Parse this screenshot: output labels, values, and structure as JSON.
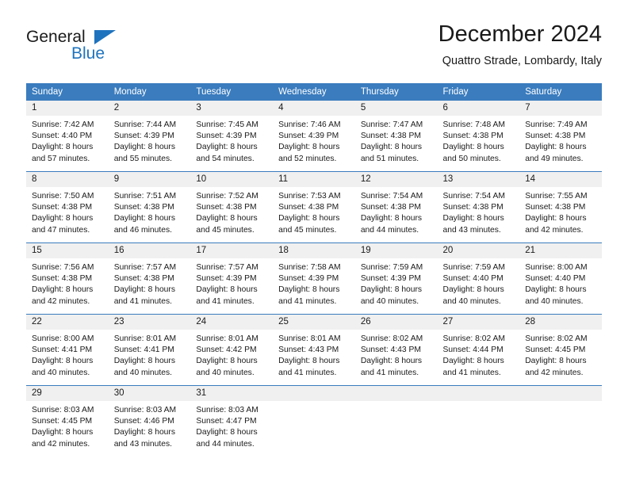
{
  "brand": {
    "name_part1": "General",
    "name_part2": "Blue",
    "triangle_color": "#1e73be",
    "text_color": "#1a1a1a"
  },
  "header": {
    "title": "December 2024",
    "subtitle": "Quattro Strade, Lombardy, Italy"
  },
  "theme": {
    "header_bg": "#3a7cbe",
    "header_text": "#ffffff",
    "daynum_bg": "#f0f0f0",
    "row_border": "#3a7cbe",
    "body_bg": "#ffffff"
  },
  "calendar": {
    "weekday_headers": [
      "Sunday",
      "Monday",
      "Tuesday",
      "Wednesday",
      "Thursday",
      "Friday",
      "Saturday"
    ],
    "labels": {
      "sunrise": "Sunrise:",
      "sunset": "Sunset:",
      "daylight": "Daylight:"
    },
    "weeks": [
      [
        {
          "day": "1",
          "sunrise": "Sunrise: 7:42 AM",
          "sunset": "Sunset: 4:40 PM",
          "daylight_line1": "Daylight: 8 hours",
          "daylight_line2": "and 57 minutes."
        },
        {
          "day": "2",
          "sunrise": "Sunrise: 7:44 AM",
          "sunset": "Sunset: 4:39 PM",
          "daylight_line1": "Daylight: 8 hours",
          "daylight_line2": "and 55 minutes."
        },
        {
          "day": "3",
          "sunrise": "Sunrise: 7:45 AM",
          "sunset": "Sunset: 4:39 PM",
          "daylight_line1": "Daylight: 8 hours",
          "daylight_line2": "and 54 minutes."
        },
        {
          "day": "4",
          "sunrise": "Sunrise: 7:46 AM",
          "sunset": "Sunset: 4:39 PM",
          "daylight_line1": "Daylight: 8 hours",
          "daylight_line2": "and 52 minutes."
        },
        {
          "day": "5",
          "sunrise": "Sunrise: 7:47 AM",
          "sunset": "Sunset: 4:38 PM",
          "daylight_line1": "Daylight: 8 hours",
          "daylight_line2": "and 51 minutes."
        },
        {
          "day": "6",
          "sunrise": "Sunrise: 7:48 AM",
          "sunset": "Sunset: 4:38 PM",
          "daylight_line1": "Daylight: 8 hours",
          "daylight_line2": "and 50 minutes."
        },
        {
          "day": "7",
          "sunrise": "Sunrise: 7:49 AM",
          "sunset": "Sunset: 4:38 PM",
          "daylight_line1": "Daylight: 8 hours",
          "daylight_line2": "and 49 minutes."
        }
      ],
      [
        {
          "day": "8",
          "sunrise": "Sunrise: 7:50 AM",
          "sunset": "Sunset: 4:38 PM",
          "daylight_line1": "Daylight: 8 hours",
          "daylight_line2": "and 47 minutes."
        },
        {
          "day": "9",
          "sunrise": "Sunrise: 7:51 AM",
          "sunset": "Sunset: 4:38 PM",
          "daylight_line1": "Daylight: 8 hours",
          "daylight_line2": "and 46 minutes."
        },
        {
          "day": "10",
          "sunrise": "Sunrise: 7:52 AM",
          "sunset": "Sunset: 4:38 PM",
          "daylight_line1": "Daylight: 8 hours",
          "daylight_line2": "and 45 minutes."
        },
        {
          "day": "11",
          "sunrise": "Sunrise: 7:53 AM",
          "sunset": "Sunset: 4:38 PM",
          "daylight_line1": "Daylight: 8 hours",
          "daylight_line2": "and 45 minutes."
        },
        {
          "day": "12",
          "sunrise": "Sunrise: 7:54 AM",
          "sunset": "Sunset: 4:38 PM",
          "daylight_line1": "Daylight: 8 hours",
          "daylight_line2": "and 44 minutes."
        },
        {
          "day": "13",
          "sunrise": "Sunrise: 7:54 AM",
          "sunset": "Sunset: 4:38 PM",
          "daylight_line1": "Daylight: 8 hours",
          "daylight_line2": "and 43 minutes."
        },
        {
          "day": "14",
          "sunrise": "Sunrise: 7:55 AM",
          "sunset": "Sunset: 4:38 PM",
          "daylight_line1": "Daylight: 8 hours",
          "daylight_line2": "and 42 minutes."
        }
      ],
      [
        {
          "day": "15",
          "sunrise": "Sunrise: 7:56 AM",
          "sunset": "Sunset: 4:38 PM",
          "daylight_line1": "Daylight: 8 hours",
          "daylight_line2": "and 42 minutes."
        },
        {
          "day": "16",
          "sunrise": "Sunrise: 7:57 AM",
          "sunset": "Sunset: 4:38 PM",
          "daylight_line1": "Daylight: 8 hours",
          "daylight_line2": "and 41 minutes."
        },
        {
          "day": "17",
          "sunrise": "Sunrise: 7:57 AM",
          "sunset": "Sunset: 4:39 PM",
          "daylight_line1": "Daylight: 8 hours",
          "daylight_line2": "and 41 minutes."
        },
        {
          "day": "18",
          "sunrise": "Sunrise: 7:58 AM",
          "sunset": "Sunset: 4:39 PM",
          "daylight_line1": "Daylight: 8 hours",
          "daylight_line2": "and 41 minutes."
        },
        {
          "day": "19",
          "sunrise": "Sunrise: 7:59 AM",
          "sunset": "Sunset: 4:39 PM",
          "daylight_line1": "Daylight: 8 hours",
          "daylight_line2": "and 40 minutes."
        },
        {
          "day": "20",
          "sunrise": "Sunrise: 7:59 AM",
          "sunset": "Sunset: 4:40 PM",
          "daylight_line1": "Daylight: 8 hours",
          "daylight_line2": "and 40 minutes."
        },
        {
          "day": "21",
          "sunrise": "Sunrise: 8:00 AM",
          "sunset": "Sunset: 4:40 PM",
          "daylight_line1": "Daylight: 8 hours",
          "daylight_line2": "and 40 minutes."
        }
      ],
      [
        {
          "day": "22",
          "sunrise": "Sunrise: 8:00 AM",
          "sunset": "Sunset: 4:41 PM",
          "daylight_line1": "Daylight: 8 hours",
          "daylight_line2": "and 40 minutes."
        },
        {
          "day": "23",
          "sunrise": "Sunrise: 8:01 AM",
          "sunset": "Sunset: 4:41 PM",
          "daylight_line1": "Daylight: 8 hours",
          "daylight_line2": "and 40 minutes."
        },
        {
          "day": "24",
          "sunrise": "Sunrise: 8:01 AM",
          "sunset": "Sunset: 4:42 PM",
          "daylight_line1": "Daylight: 8 hours",
          "daylight_line2": "and 40 minutes."
        },
        {
          "day": "25",
          "sunrise": "Sunrise: 8:01 AM",
          "sunset": "Sunset: 4:43 PM",
          "daylight_line1": "Daylight: 8 hours",
          "daylight_line2": "and 41 minutes."
        },
        {
          "day": "26",
          "sunrise": "Sunrise: 8:02 AM",
          "sunset": "Sunset: 4:43 PM",
          "daylight_line1": "Daylight: 8 hours",
          "daylight_line2": "and 41 minutes."
        },
        {
          "day": "27",
          "sunrise": "Sunrise: 8:02 AM",
          "sunset": "Sunset: 4:44 PM",
          "daylight_line1": "Daylight: 8 hours",
          "daylight_line2": "and 41 minutes."
        },
        {
          "day": "28",
          "sunrise": "Sunrise: 8:02 AM",
          "sunset": "Sunset: 4:45 PM",
          "daylight_line1": "Daylight: 8 hours",
          "daylight_line2": "and 42 minutes."
        }
      ],
      [
        {
          "day": "29",
          "sunrise": "Sunrise: 8:03 AM",
          "sunset": "Sunset: 4:45 PM",
          "daylight_line1": "Daylight: 8 hours",
          "daylight_line2": "and 42 minutes."
        },
        {
          "day": "30",
          "sunrise": "Sunrise: 8:03 AM",
          "sunset": "Sunset: 4:46 PM",
          "daylight_line1": "Daylight: 8 hours",
          "daylight_line2": "and 43 minutes."
        },
        {
          "day": "31",
          "sunrise": "Sunrise: 8:03 AM",
          "sunset": "Sunset: 4:47 PM",
          "daylight_line1": "Daylight: 8 hours",
          "daylight_line2": "and 44 minutes."
        },
        {
          "day": "",
          "sunrise": "",
          "sunset": "",
          "daylight_line1": "",
          "daylight_line2": ""
        },
        {
          "day": "",
          "sunrise": "",
          "sunset": "",
          "daylight_line1": "",
          "daylight_line2": ""
        },
        {
          "day": "",
          "sunrise": "",
          "sunset": "",
          "daylight_line1": "",
          "daylight_line2": ""
        },
        {
          "day": "",
          "sunrise": "",
          "sunset": "",
          "daylight_line1": "",
          "daylight_line2": ""
        }
      ]
    ]
  }
}
